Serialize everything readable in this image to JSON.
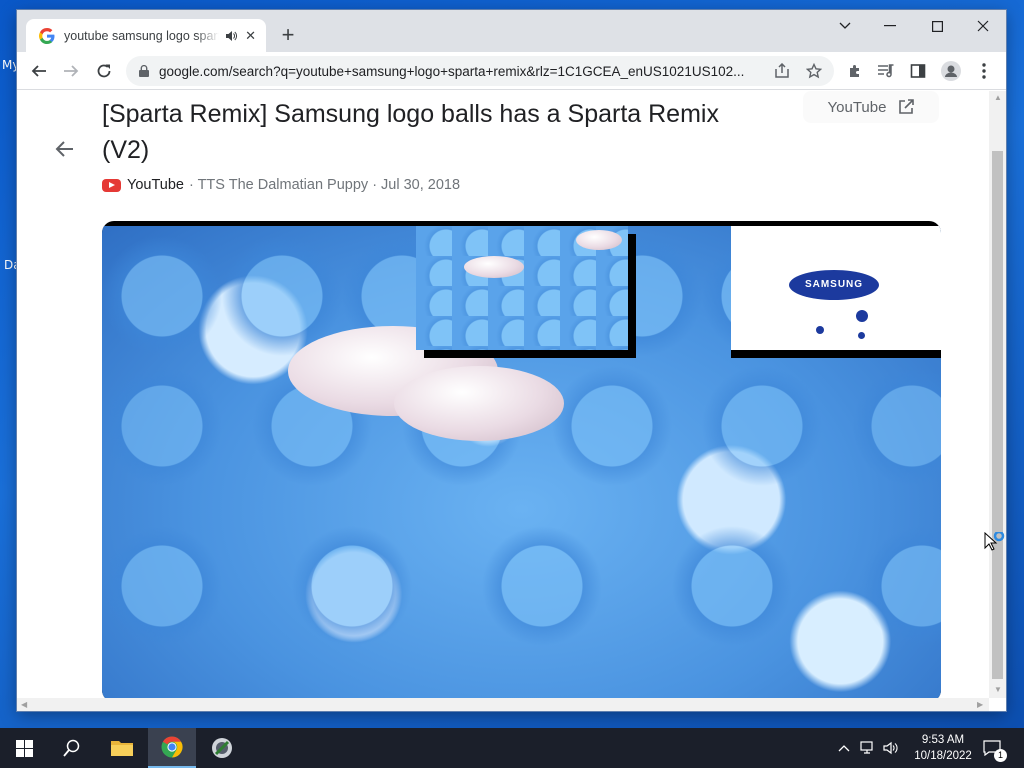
{
  "desktop": {
    "icon_labels": [
      "My",
      "Da"
    ]
  },
  "tab": {
    "title": "youtube samsung logo sparta remix",
    "audio_icon": "speaker-icon",
    "close_symbol": "✕"
  },
  "newtab_symbol": "+",
  "window_controls": {
    "dropdown": "⌄",
    "minimize": "—",
    "maximize": "☐",
    "close": "✕"
  },
  "toolbar": {
    "url": "google.com/search?q=youtube+samsung+logo+sparta+remix&rlz=1C1GCEA_enUS1021US102..."
  },
  "result": {
    "title": "[Sparta Remix] Samsung logo balls has a Sparta Remix (V2)",
    "open_label": "YouTube",
    "source": "YouTube",
    "meta": "· TTS The Dalmatian Puppy · Jul 30, 2018",
    "samsung_logo_text": "SAMSUNG"
  },
  "taskbar": {
    "time": "9:53 AM",
    "date": "10/18/2022",
    "notification_count": "1"
  },
  "colors": {
    "accent": "#1a73e8",
    "youtube_red": "#e53935",
    "taskbar": "#1b1f2a",
    "desktop": "#0a58c8"
  }
}
